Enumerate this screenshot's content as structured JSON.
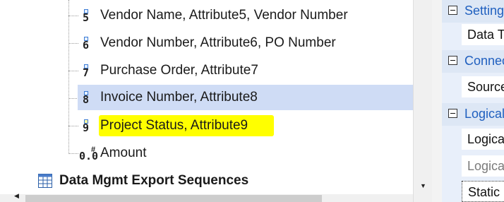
{
  "tree": {
    "items": [
      {
        "icon": "5",
        "label": "Vendor Name, Attribute5, Vendor Number"
      },
      {
        "icon": "6",
        "label": "Vendor Number, Attribute6, PO Number"
      },
      {
        "icon": "7",
        "label": "Purchase Order, Attribute7"
      },
      {
        "icon": "8",
        "label": "Invoice Number, Attribute8"
      },
      {
        "icon": "9",
        "label": "Project Status, Attribute9"
      },
      {
        "icon": "0.0",
        "label": "Amount"
      }
    ],
    "selected_index": 3,
    "highlighted_index": 4,
    "section": {
      "label": "Data Mgmt Export Sequences",
      "icon": "table-grid-icon"
    }
  },
  "properties": {
    "categories": [
      {
        "label": "Settings",
        "rows": [
          "Data T"
        ]
      },
      {
        "label": "Connections",
        "rows": [
          "Source"
        ]
      },
      {
        "label": "Logical",
        "rows": [
          "Logica",
          "Logica",
          "Static"
        ]
      }
    ]
  },
  "colors": {
    "selection": "#cfdcf5",
    "highlight": "#ffff00",
    "category_text": "#1f5fbf",
    "property_bg": "#e8effa"
  }
}
